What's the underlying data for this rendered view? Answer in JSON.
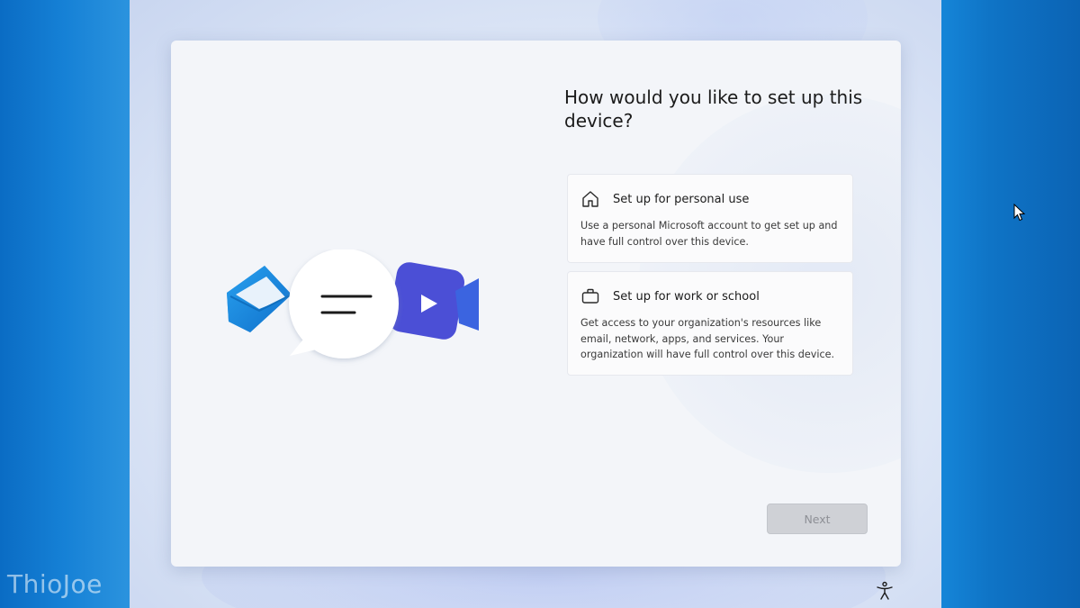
{
  "oobe": {
    "title": "How would you like to set up this device?",
    "options": [
      {
        "icon": "home-icon",
        "title": "Set up for personal use",
        "description": "Use a personal Microsoft account to get set up and have full control over this device."
      },
      {
        "icon": "briefcase-icon",
        "title": "Set up for work or school",
        "description": "Get access to your organization's resources like email, network, apps, and services. Your organization will have full control over this device."
      }
    ],
    "next_label": "Next",
    "next_enabled": false
  },
  "illustration": {
    "icons": [
      "mail-icon",
      "chat-bubble-icon",
      "video-camera-icon"
    ]
  },
  "footer": {
    "accessibility_icon": "accessibility-icon"
  },
  "watermark": "ThioJoe",
  "colors": {
    "desktop": "#1585d8",
    "card": "#f3f5f9",
    "next_disabled": "#cfd1d6",
    "accent_mail": "#1a8fe0",
    "accent_video": "#4a4fd8"
  }
}
